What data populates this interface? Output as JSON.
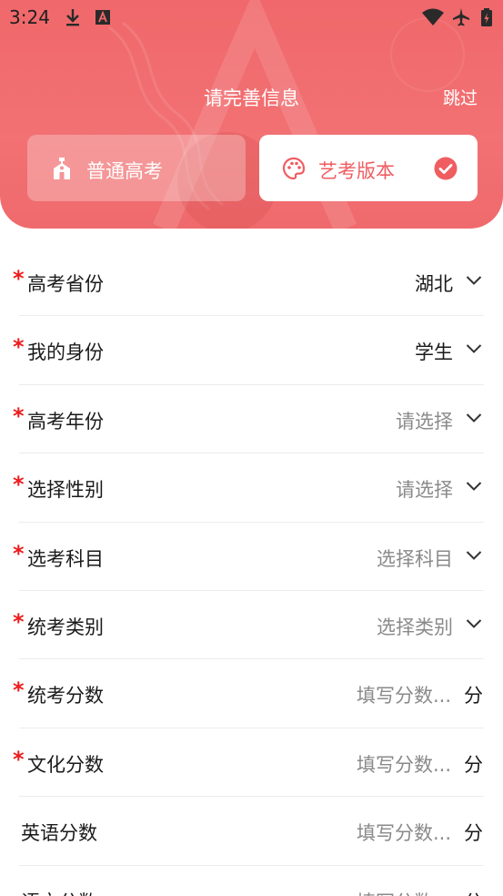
{
  "status_bar": {
    "time": "3:24",
    "left_icons": [
      "download-icon",
      "a-notification-icon"
    ],
    "right_icons": [
      "wifi-icon",
      "airplane-icon",
      "battery-charging-icon"
    ]
  },
  "header": {
    "title": "请完善信息",
    "skip_label": "跳过",
    "gradient_colors": [
      "#f0686b",
      "#ef6a6c"
    ]
  },
  "modes": [
    {
      "label": "普通高考",
      "icon": "school-icon",
      "selected": false
    },
    {
      "label": "艺考版本",
      "icon": "palette-icon",
      "selected": true
    }
  ],
  "accent_color": "#ef5d61",
  "form": {
    "rows": [
      {
        "label": "高考省份",
        "required": true,
        "kind": "select",
        "value": "湖北",
        "is_placeholder": false
      },
      {
        "label": "我的身份",
        "required": true,
        "kind": "select",
        "value": "学生",
        "is_placeholder": false
      },
      {
        "label": "高考年份",
        "required": true,
        "kind": "select",
        "value": "请选择",
        "is_placeholder": true
      },
      {
        "label": "选择性别",
        "required": true,
        "kind": "select",
        "value": "请选择",
        "is_placeholder": true
      },
      {
        "label": "选考科目",
        "required": true,
        "kind": "select",
        "value": "选择科目",
        "is_placeholder": true
      },
      {
        "label": "统考类别",
        "required": true,
        "kind": "select",
        "value": "选择类别",
        "is_placeholder": true
      },
      {
        "label": "统考分数",
        "required": true,
        "kind": "input",
        "placeholder": "填写分数...",
        "unit": "分"
      },
      {
        "label": "文化分数",
        "required": true,
        "kind": "input",
        "placeholder": "填写分数...",
        "unit": "分"
      },
      {
        "label": "英语分数",
        "required": false,
        "kind": "input",
        "placeholder": "填写分数...",
        "unit": "分"
      },
      {
        "label": "语文分数",
        "required": false,
        "kind": "input",
        "placeholder": "填写分数...",
        "unit": "分"
      }
    ]
  },
  "required_mark": "*"
}
